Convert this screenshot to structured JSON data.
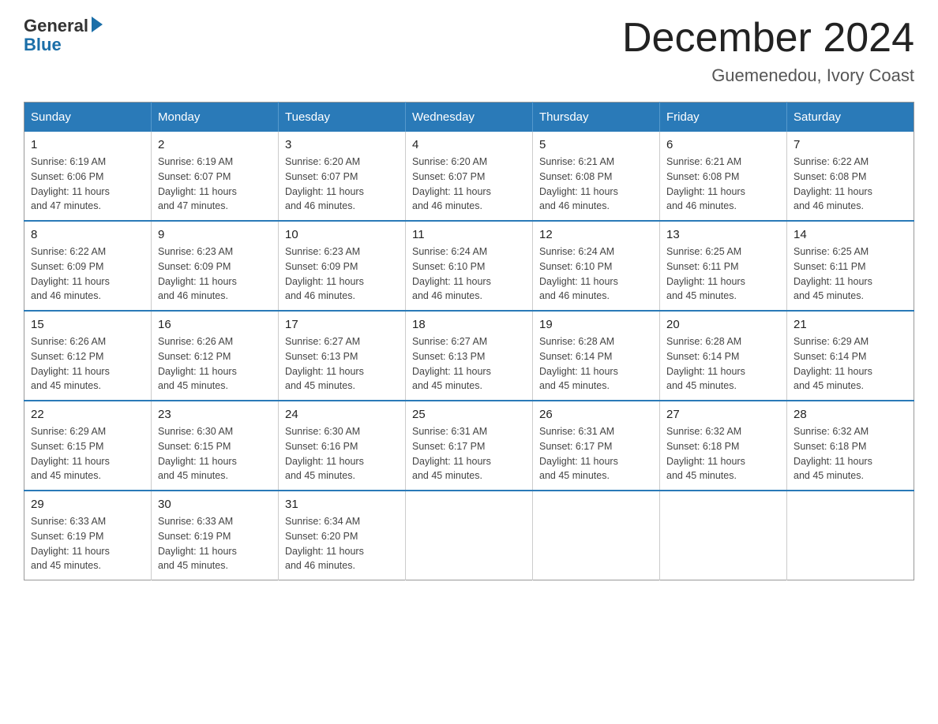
{
  "logo": {
    "general": "General",
    "blue": "Blue"
  },
  "title": "December 2024",
  "subtitle": "Guemenedou, Ivory Coast",
  "days_header": [
    "Sunday",
    "Monday",
    "Tuesday",
    "Wednesday",
    "Thursday",
    "Friday",
    "Saturday"
  ],
  "weeks": [
    [
      {
        "day": "1",
        "sunrise": "6:19 AM",
        "sunset": "6:06 PM",
        "daylight": "11 hours and 47 minutes."
      },
      {
        "day": "2",
        "sunrise": "6:19 AM",
        "sunset": "6:07 PM",
        "daylight": "11 hours and 47 minutes."
      },
      {
        "day": "3",
        "sunrise": "6:20 AM",
        "sunset": "6:07 PM",
        "daylight": "11 hours and 46 minutes."
      },
      {
        "day": "4",
        "sunrise": "6:20 AM",
        "sunset": "6:07 PM",
        "daylight": "11 hours and 46 minutes."
      },
      {
        "day": "5",
        "sunrise": "6:21 AM",
        "sunset": "6:08 PM",
        "daylight": "11 hours and 46 minutes."
      },
      {
        "day": "6",
        "sunrise": "6:21 AM",
        "sunset": "6:08 PM",
        "daylight": "11 hours and 46 minutes."
      },
      {
        "day": "7",
        "sunrise": "6:22 AM",
        "sunset": "6:08 PM",
        "daylight": "11 hours and 46 minutes."
      }
    ],
    [
      {
        "day": "8",
        "sunrise": "6:22 AM",
        "sunset": "6:09 PM",
        "daylight": "11 hours and 46 minutes."
      },
      {
        "day": "9",
        "sunrise": "6:23 AM",
        "sunset": "6:09 PM",
        "daylight": "11 hours and 46 minutes."
      },
      {
        "day": "10",
        "sunrise": "6:23 AM",
        "sunset": "6:09 PM",
        "daylight": "11 hours and 46 minutes."
      },
      {
        "day": "11",
        "sunrise": "6:24 AM",
        "sunset": "6:10 PM",
        "daylight": "11 hours and 46 minutes."
      },
      {
        "day": "12",
        "sunrise": "6:24 AM",
        "sunset": "6:10 PM",
        "daylight": "11 hours and 46 minutes."
      },
      {
        "day": "13",
        "sunrise": "6:25 AM",
        "sunset": "6:11 PM",
        "daylight": "11 hours and 45 minutes."
      },
      {
        "day": "14",
        "sunrise": "6:25 AM",
        "sunset": "6:11 PM",
        "daylight": "11 hours and 45 minutes."
      }
    ],
    [
      {
        "day": "15",
        "sunrise": "6:26 AM",
        "sunset": "6:12 PM",
        "daylight": "11 hours and 45 minutes."
      },
      {
        "day": "16",
        "sunrise": "6:26 AM",
        "sunset": "6:12 PM",
        "daylight": "11 hours and 45 minutes."
      },
      {
        "day": "17",
        "sunrise": "6:27 AM",
        "sunset": "6:13 PM",
        "daylight": "11 hours and 45 minutes."
      },
      {
        "day": "18",
        "sunrise": "6:27 AM",
        "sunset": "6:13 PM",
        "daylight": "11 hours and 45 minutes."
      },
      {
        "day": "19",
        "sunrise": "6:28 AM",
        "sunset": "6:14 PM",
        "daylight": "11 hours and 45 minutes."
      },
      {
        "day": "20",
        "sunrise": "6:28 AM",
        "sunset": "6:14 PM",
        "daylight": "11 hours and 45 minutes."
      },
      {
        "day": "21",
        "sunrise": "6:29 AM",
        "sunset": "6:14 PM",
        "daylight": "11 hours and 45 minutes."
      }
    ],
    [
      {
        "day": "22",
        "sunrise": "6:29 AM",
        "sunset": "6:15 PM",
        "daylight": "11 hours and 45 minutes."
      },
      {
        "day": "23",
        "sunrise": "6:30 AM",
        "sunset": "6:15 PM",
        "daylight": "11 hours and 45 minutes."
      },
      {
        "day": "24",
        "sunrise": "6:30 AM",
        "sunset": "6:16 PM",
        "daylight": "11 hours and 45 minutes."
      },
      {
        "day": "25",
        "sunrise": "6:31 AM",
        "sunset": "6:17 PM",
        "daylight": "11 hours and 45 minutes."
      },
      {
        "day": "26",
        "sunrise": "6:31 AM",
        "sunset": "6:17 PM",
        "daylight": "11 hours and 45 minutes."
      },
      {
        "day": "27",
        "sunrise": "6:32 AM",
        "sunset": "6:18 PM",
        "daylight": "11 hours and 45 minutes."
      },
      {
        "day": "28",
        "sunrise": "6:32 AM",
        "sunset": "6:18 PM",
        "daylight": "11 hours and 45 minutes."
      }
    ],
    [
      {
        "day": "29",
        "sunrise": "6:33 AM",
        "sunset": "6:19 PM",
        "daylight": "11 hours and 45 minutes."
      },
      {
        "day": "30",
        "sunrise": "6:33 AM",
        "sunset": "6:19 PM",
        "daylight": "11 hours and 45 minutes."
      },
      {
        "day": "31",
        "sunrise": "6:34 AM",
        "sunset": "6:20 PM",
        "daylight": "11 hours and 46 minutes."
      },
      null,
      null,
      null,
      null
    ]
  ],
  "labels": {
    "sunrise": "Sunrise:",
    "sunset": "Sunset:",
    "daylight": "Daylight:"
  }
}
